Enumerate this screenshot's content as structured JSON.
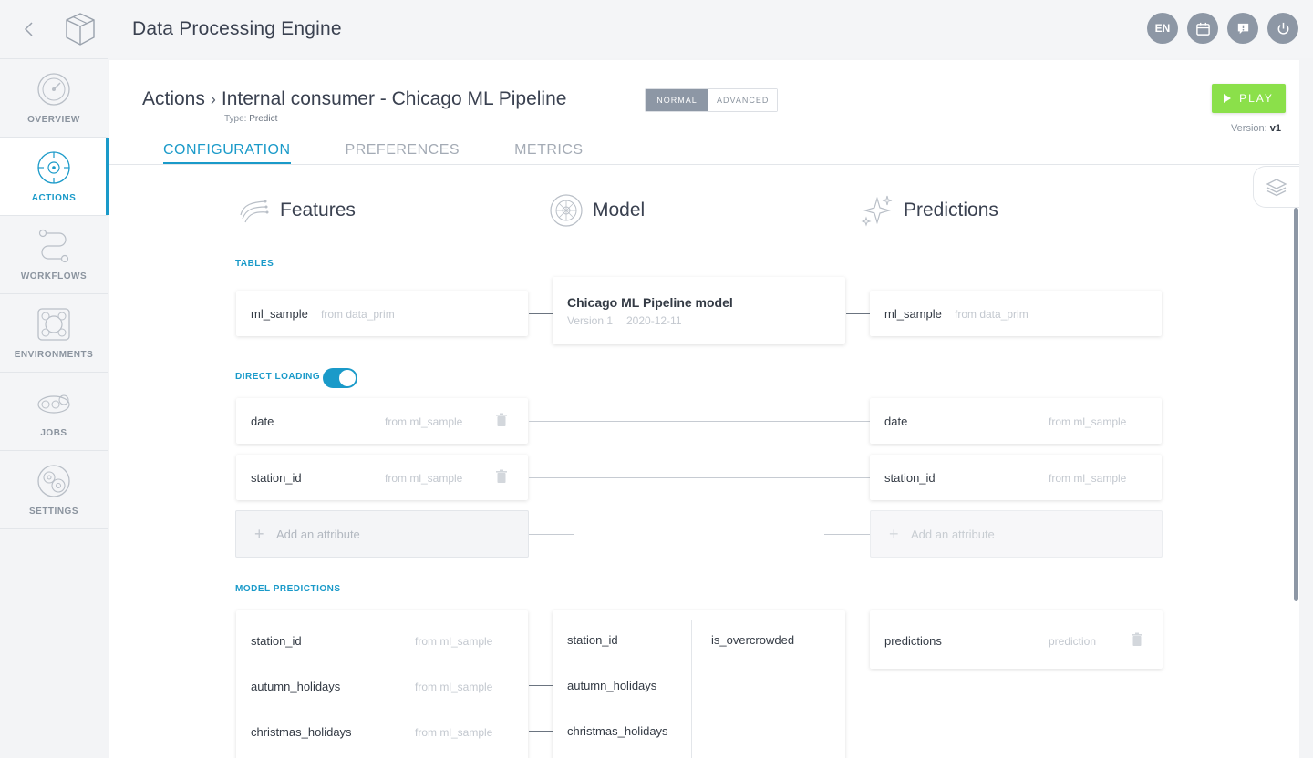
{
  "app": {
    "title": "Data Processing Engine",
    "lang": "EN"
  },
  "sidebar": {
    "items": [
      {
        "label": "OVERVIEW"
      },
      {
        "label": "ACTIONS"
      },
      {
        "label": "WORKFLOWS"
      },
      {
        "label": "ENVIRONMENTS"
      },
      {
        "label": "JOBS"
      },
      {
        "label": "SETTINGS"
      }
    ]
  },
  "header": {
    "breadcrumb_root": "Actions",
    "breadcrumb_name": "Internal consumer - Chicago ML Pipeline",
    "type_label": "Type:",
    "type_value": "Predict",
    "mode_normal": "NORMAL",
    "mode_advanced": "ADVANCED",
    "play_label": "PLAY",
    "version_label": "Version:",
    "version_value": "v1"
  },
  "tabs": [
    {
      "label": "CONFIGURATION",
      "active": true
    },
    {
      "label": "PREFERENCES",
      "active": false
    },
    {
      "label": "METRICS",
      "active": false
    }
  ],
  "columns": {
    "features": "Features",
    "model": "Model",
    "predictions": "Predictions"
  },
  "tables": {
    "section": "TABLES",
    "left": {
      "name": "ml_sample",
      "source": "from data_prim"
    },
    "model": {
      "name": "Chicago ML Pipeline model",
      "version": "Version 1",
      "date": "2020-12-11"
    },
    "right": {
      "name": "ml_sample",
      "source": "from data_prim"
    }
  },
  "direct_loading": {
    "label": "DIRECT LOADING",
    "enabled": true,
    "left": [
      {
        "name": "date",
        "source": "from ml_sample"
      },
      {
        "name": "station_id",
        "source": "from ml_sample"
      }
    ],
    "right": [
      {
        "name": "date",
        "source": "from ml_sample"
      },
      {
        "name": "station_id",
        "source": "from ml_sample"
      }
    ],
    "add_label": "Add an attribute"
  },
  "model_predictions": {
    "label": "MODEL PREDICTIONS",
    "features": [
      {
        "name": "station_id",
        "source": "from ml_sample"
      },
      {
        "name": "autumn_holidays",
        "source": "from ml_sample"
      },
      {
        "name": "christmas_holidays",
        "source": "from ml_sample"
      }
    ],
    "model_inputs": [
      "station_id",
      "autumn_holidays",
      "christmas_holidays"
    ],
    "model_output": "is_overcrowded",
    "prediction": {
      "name": "predictions",
      "source": "prediction"
    }
  },
  "colors": {
    "accent": "#1a9ac9",
    "play": "#8be04a",
    "toggle_grey": "#8d97a5"
  }
}
